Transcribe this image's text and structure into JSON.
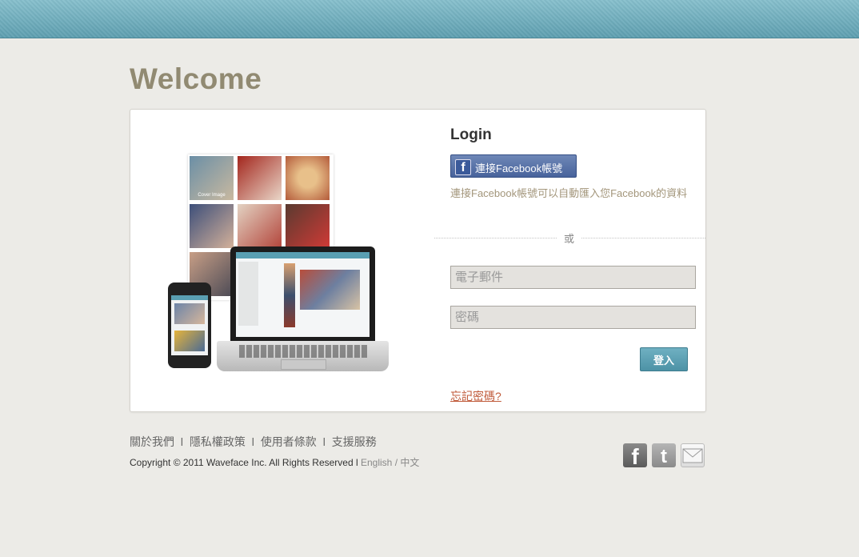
{
  "header": {
    "title": "Welcome"
  },
  "illustration": {
    "cover_caption": "Cover Image"
  },
  "login": {
    "title": "Login",
    "facebook_button": "連接Facebook帳號",
    "facebook_desc": "連接Facebook帳號可以自動匯入您Facebook的資料",
    "or": "或",
    "email_placeholder": "電子郵件",
    "password_placeholder": "密碼",
    "submit": "登入",
    "forgot": "忘記密碼?"
  },
  "footer": {
    "links": [
      "關於我們",
      "隱私權政策",
      "使用者條款",
      "支援服務"
    ],
    "separator": "l",
    "copyright": "Copyright © 2011 Waveface Inc. All Rights Reserved",
    "lang_sep": "l",
    "lang_en": "English",
    "lang_slash": "/",
    "lang_zh": "中文"
  },
  "social": [
    "facebook-icon",
    "twitter-icon",
    "mail-icon"
  ],
  "colors": {
    "topbar": "#6aaabb",
    "welcome": "#918a72",
    "accent": "#4d92a6",
    "link": "#c05a3a"
  }
}
